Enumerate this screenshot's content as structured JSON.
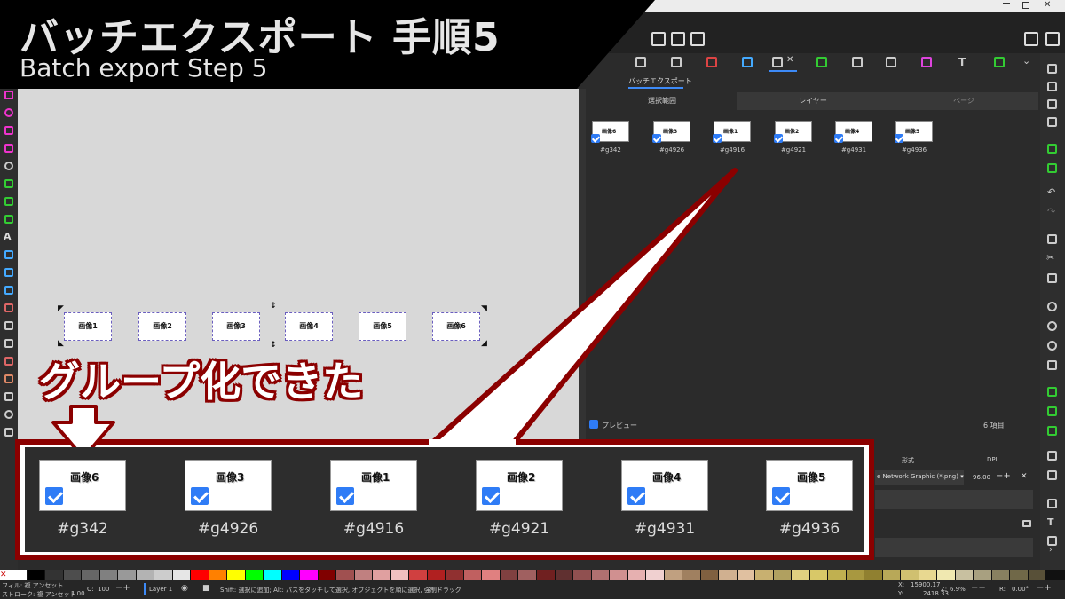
{
  "title": {
    "japanese": "バッチエクスポート 手順5",
    "english": "Batch export Step 5"
  },
  "callout": {
    "text": "グループ化できた",
    "colors": {
      "frame": "#8b0000",
      "fill": "#ffffff"
    }
  },
  "dock": {
    "tab_label": "バッチエクスポート",
    "subtabs": [
      "選択範囲",
      "レイヤー",
      "ページ"
    ],
    "items": [
      {
        "label": "画像6",
        "id": "#g342"
      },
      {
        "label": "画像3",
        "id": "#g4926"
      },
      {
        "label": "画像1",
        "id": "#g4916"
      },
      {
        "label": "画像2",
        "id": "#g4921"
      },
      {
        "label": "画像4",
        "id": "#g4931"
      },
      {
        "label": "画像5",
        "id": "#g4936"
      }
    ],
    "preview_label": "プレビュー",
    "count_label": "6 項目",
    "format_label": "形式",
    "dpi_label": "DPI",
    "format_value": "e Network Graphic (*.png)",
    "dpi_value": "96.00"
  },
  "canvas": {
    "boxes": [
      "画像1",
      "画像2",
      "画像3",
      "画像4",
      "画像5",
      "画像6"
    ]
  },
  "status": {
    "fill_label": "フィル: 複 アンセット",
    "stroke_label": "ストローク: 複 アンセット",
    "stroke_width": "1.00",
    "opacity_label": "O:",
    "opacity_value": "100",
    "layer": "Layer 1",
    "hint": "Shift: 選択に追加; Alt: パスをタッチして選択, オブジェクトを順に選択, 強制ドラッグ",
    "x_label": "X:",
    "x_value": "15900.17",
    "y_label": "Y:",
    "y_value": "2418.33",
    "zoom_label": "Z:",
    "zoom_value": "6.9%",
    "rot_label": "R:",
    "rot_value": "0.00°"
  },
  "palette": [
    "#ffffff",
    "#000000",
    "#333333",
    "#4d4d4d",
    "#666666",
    "#808080",
    "#999999",
    "#b3b3b3",
    "#cccccc",
    "#e6e6e6",
    "#ff0000",
    "#ff8000",
    "#ffff00",
    "#00ff00",
    "#00ffff",
    "#0000ff",
    "#ff00ff",
    "#800000",
    "#a05050",
    "#c08080",
    "#e0a0a0",
    "#f0c0c0",
    "#d04040",
    "#b02020",
    "#903030",
    "#c06060",
    "#e08080",
    "#804040",
    "#a06060",
    "#702020",
    "#603030",
    "#905050",
    "#b07070",
    "#d09090",
    "#e6b0b0",
    "#f0d0d0",
    "#c0a080",
    "#a08060",
    "#806040",
    "#d0b090",
    "#e0c0a0",
    "#c8b070",
    "#b0a060",
    "#e0d080",
    "#d8c868",
    "#c0b050",
    "#a89840",
    "#908030",
    "#b8a858",
    "#d0c070",
    "#e8d890",
    "#f0e8b0",
    "#c8c0a0",
    "#a8a080",
    "#888060",
    "#706848",
    "#585038"
  ]
}
